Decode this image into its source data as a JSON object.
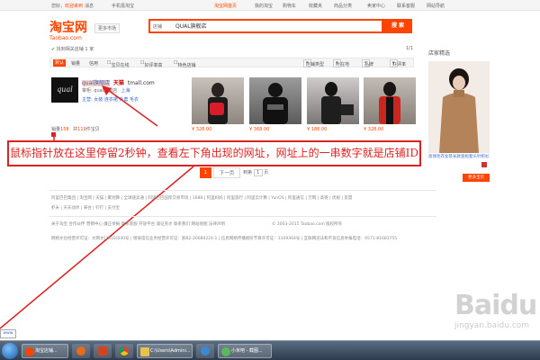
{
  "topbar": {
    "greeting": "您好，",
    "user": "欢迎来到",
    "messages": "消息",
    "mobile": "手机逛淘宝",
    "taobao_home": "淘宝网首页",
    "my_taobao": "我的淘宝",
    "cart": "购物车",
    "favorites": "收藏夹",
    "goods_category": "商品分类",
    "seller_center": "卖家中心",
    "contact": "联系客服",
    "sitemap": "网站导航"
  },
  "logo": {
    "cn": "淘宝网",
    "en": "Taobao.com"
  },
  "region": "更多市场",
  "search": {
    "scope": "店铺",
    "query": "QUAL旗舰店",
    "button": "搜 索"
  },
  "results": {
    "found_prefix": "找到相关店铺",
    "found_count": "1",
    "found_suffix": "家",
    "page": "1/1"
  },
  "filters": {
    "tab_default": "默认",
    "sales": "销量",
    "credit": "信用",
    "opt1": "宝贝在线",
    "opt2": "好评率高",
    "opt3": "特色店铺",
    "dd1": "店铺类型",
    "dd2": "所在地",
    "dd3": "品牌",
    "dd4": "好评率"
  },
  "shop": {
    "logo_text": "qual",
    "name": "qual旗舰店",
    "tmall": "天猫",
    "url": "tmall.com",
    "owner_label": "掌柜: qual旗舰店",
    "location": "上海",
    "line3": "主营: 女装 连衣裙 外套 毛衣",
    "sales_prefix": "销量",
    "sales_count": "158",
    "items_prefix": "共",
    "items_count": "119",
    "items_suffix": "件宝贝"
  },
  "products": [
    {
      "price": "¥ 328.00"
    },
    {
      "price": "¥ 368.00"
    },
    {
      "price": "¥ 188.00"
    },
    {
      "price": "¥ 328.00"
    }
  ],
  "right": {
    "title": "店家精选",
    "desc": "高领毛衣女装长款宽松套头针织衫",
    "button": "更多宝贝"
  },
  "annotation": "鼠标指针放在这里停留2秒钟，查看左下角出现的网址，网址上的一串数字就是店铺ID",
  "pager": {
    "current": "1",
    "next": "下一页",
    "go_prefix": "到第",
    "go_value": "1",
    "go_suffix": "页"
  },
  "footer": {
    "row1": "阿里巴巴集团 | 淘宝网 | 天猫 | 聚划算 | 全球速卖通 | 阿里巴巴国际交易市场 | 1688 | 阿里妈妈 | 阿里旅行 | 阿里云计算 | YunOS | 阿里通信 | 万网 | 高德 | 优视 | 友盟",
    "row2": "虾米 | 天天动听 | 来往 | 钉钉 | 支付宝",
    "row3": "关于淘宝 合作伙伴 营销中心 廉正举报 联系客服 开放平台 诚征英才 联系我们 网站地图 法律声明",
    "copyright": "© 2003-2015 Taobao.com 版权所有",
    "row4": "网络文化经营许可证：文网文[2010]040号 | 增值电信业务经营许可证：浙B2-20080224-1 | 信息网络传播视听节目许可证：1109364号 | 互联网违法和不良信息举报电话：0571-81683755"
  },
  "taskbar": {
    "left_tab": "www",
    "win1": "淘宝店铺...",
    "win2": "C:\\Users\\Admini...",
    "win3": "小米吧 - 截图..."
  },
  "watermark": {
    "main": "Baidu",
    "sub": "jingyan.baidu.com"
  }
}
